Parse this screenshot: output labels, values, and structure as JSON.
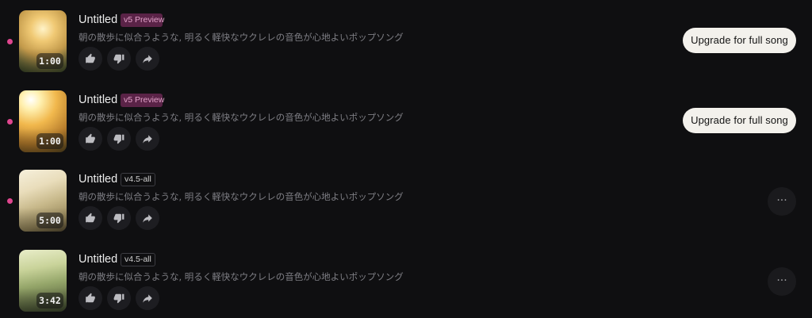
{
  "songs": [
    {
      "title": "Untitled",
      "version": "v5 Preview",
      "description": "朝の散歩に似合うような, 明るく軽快なウクレレの音色が心地よいポップソング",
      "duration": "1:00",
      "action_label": "Upgrade for full song",
      "unread": true
    },
    {
      "title": "Untitled",
      "version": "v5 Preview",
      "description": "朝の散歩に似合うような, 明るく軽快なウクレレの音色が心地よいポップソング",
      "duration": "1:00",
      "action_label": "Upgrade for full song",
      "unread": true
    },
    {
      "title": "Untitled",
      "version": "v4.5-all",
      "description": "朝の散歩に似合うような, 明るく軽快なウクレレの音色が心地よいポップソング",
      "duration": "5:00",
      "more_icon": "···",
      "unread": true
    },
    {
      "title": "Untitled",
      "version": "v4.5-all",
      "description": "朝の散歩に似合うような, 明るく軽快なウクレレの音色が心地よいポップソング",
      "duration": "3:42",
      "more_icon": "···",
      "unread": false
    }
  ],
  "icons": {
    "like": "thumbs-up-icon",
    "dislike": "thumbs-down-icon",
    "share": "share-arrow-icon",
    "more": "more-horizontal-icon"
  },
  "colors": {
    "background": "#0f0f11",
    "unread_dot": "#e0468f",
    "preview_badge_bg": "#5a2347",
    "preview_badge_text": "#e2a2c9",
    "upgrade_button_bg": "#f3f1ec"
  }
}
